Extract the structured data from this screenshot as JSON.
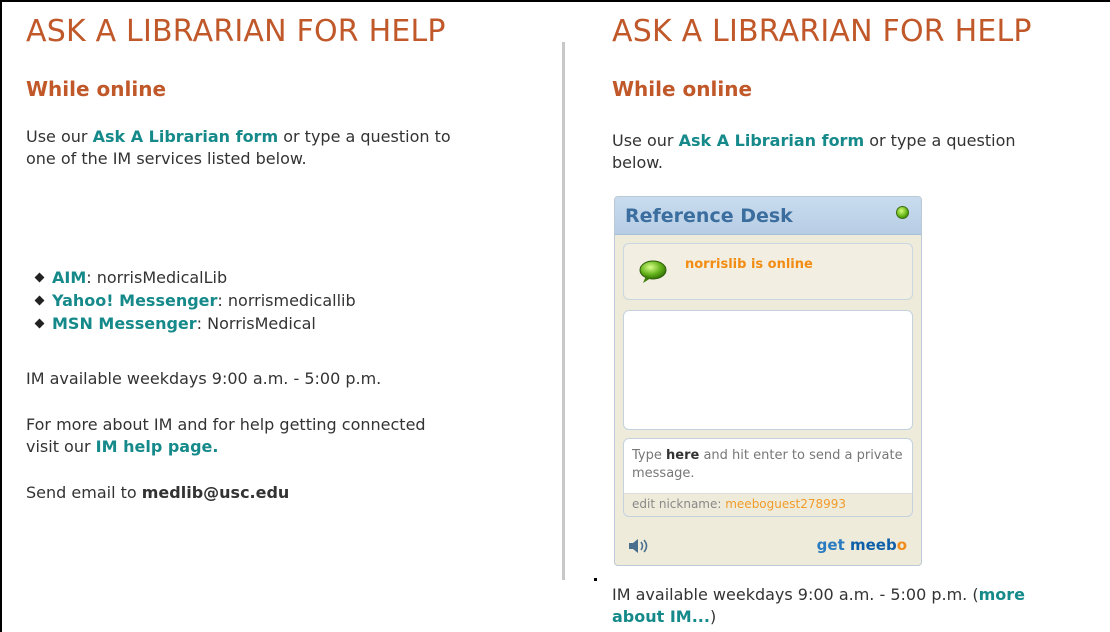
{
  "left": {
    "heading": "ASK A LIBRARIAN FOR HELP",
    "subheading": "While online",
    "intro_prefix": "Use our ",
    "intro_link": "Ask A Librarian form",
    "intro_suffix": " or type a question to one of the IM services listed below.",
    "im_services": [
      {
        "name": "AIM",
        "handle": ": norrisMedicalLib"
      },
      {
        "name": "Yahoo! Messenger",
        "handle": ": norrismedicallib"
      },
      {
        "name": "MSN Messenger",
        "handle": ": NorrisMedical"
      }
    ],
    "availability": "IM available weekdays 9:00 a.m. - 5:00 p.m.",
    "help_prefix": "For more about IM and for help getting connected visit our ",
    "help_link": "IM help page.",
    "email_prefix": "Send email to ",
    "email": "medlib@usc.edu"
  },
  "right": {
    "heading": "ASK A LIBRARIAN FOR HELP",
    "subheading": "While online",
    "intro_prefix": "Use our ",
    "intro_link": "Ask A Librarian form",
    "intro_suffix": " or type a question below.",
    "widget": {
      "title": "Reference Desk",
      "status": "norrislib is online",
      "input_prefix": "Type ",
      "input_bold": "here",
      "input_suffix": " and hit enter to send a private message.",
      "nick_label": "edit nickname: ",
      "nick_value": "meeboguest278993",
      "get_prefix": "get ",
      "get_brand": "meeb",
      "get_o": "o"
    },
    "availability_prefix": "IM available weekdays 9:00 a.m. - 5:00 p.m. (",
    "availability_link": "more about IM...",
    "availability_suffix": ")"
  },
  "colors": {
    "heading": "#c0582a",
    "link": "#168a8a",
    "status": "#f28c13",
    "widget_title": "#3b6e9e"
  },
  "icons": [
    "online-status-icon",
    "chat-bubble-icon",
    "speaker-icon",
    "bullet-icon"
  ]
}
